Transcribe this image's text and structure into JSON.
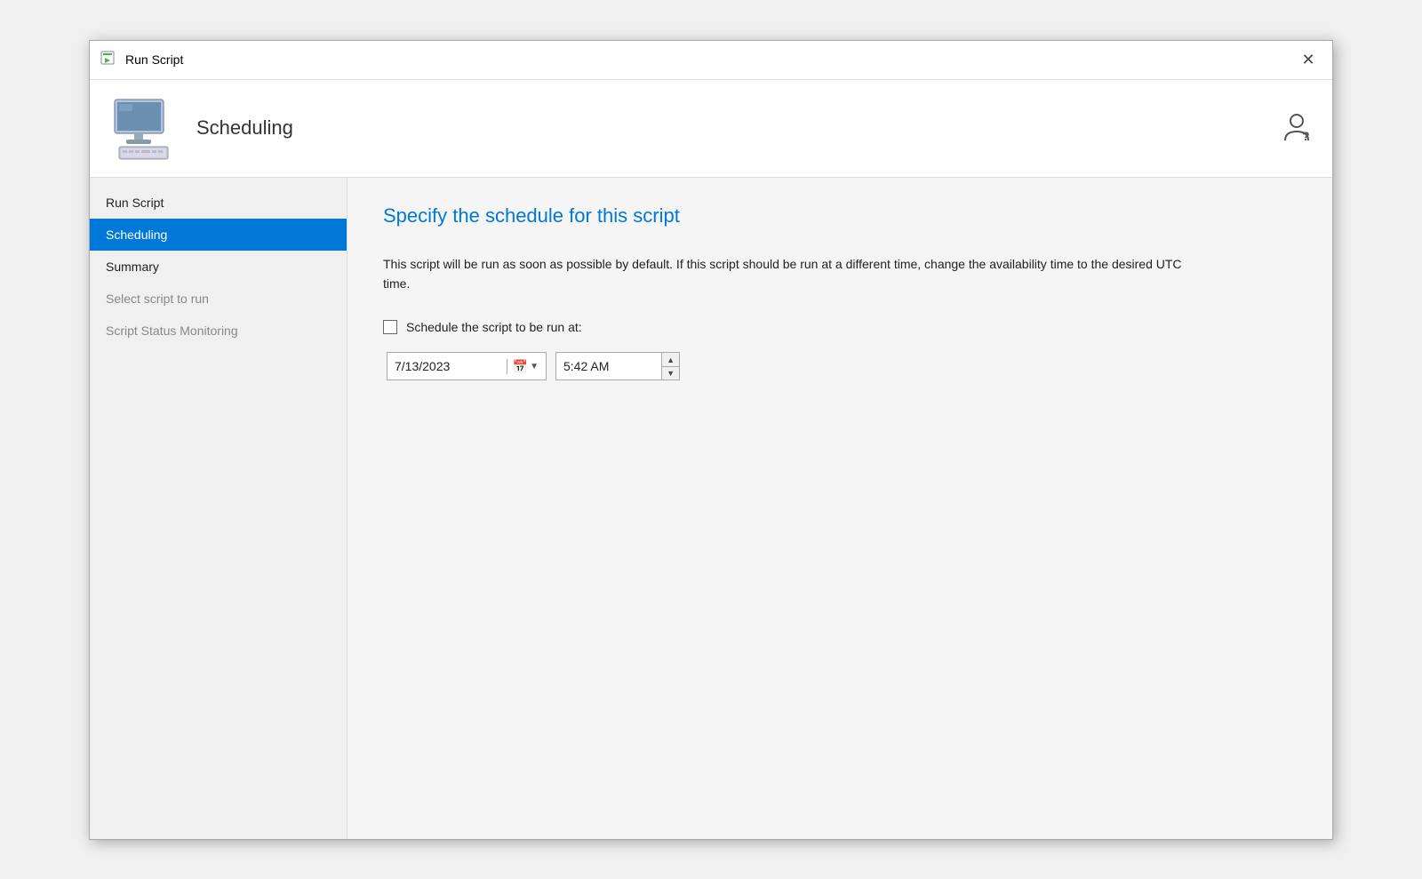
{
  "titleBar": {
    "icon": "script-icon",
    "title": "Run Script",
    "closeLabel": "✕"
  },
  "header": {
    "title": "Scheduling",
    "computerIcon": "computer-icon",
    "personIcon": "person-icon"
  },
  "sidebar": {
    "items": [
      {
        "label": "Run Script",
        "state": "normal"
      },
      {
        "label": "Scheduling",
        "state": "active"
      },
      {
        "label": "Summary",
        "state": "normal"
      },
      {
        "label": "Select script to run",
        "state": "disabled"
      },
      {
        "label": "Script Status Monitoring",
        "state": "disabled"
      }
    ]
  },
  "main": {
    "title": "Specify the schedule for this script",
    "description": "This script will be run as soon as possible by default. If this script should be run at a different time, change the availability time to the desired UTC time.",
    "scheduleCheckboxLabel": "Schedule the script to be run at:",
    "dateValue": "7/13/2023",
    "timeValue": "5:42 AM",
    "checked": false
  }
}
